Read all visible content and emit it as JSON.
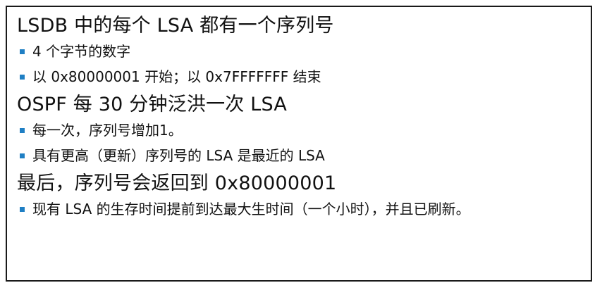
{
  "accent_color": "#1f7fc4",
  "sections": [
    {
      "heading": "LSDB 中的每个 LSA 都有一个序列号",
      "bullets": [
        "4 个字节的数字",
        "以 0x80000001 开始；以 0x7FFFFFFF 结束"
      ]
    },
    {
      "heading": "OSPF 每 30 分钟泛洪一次 LSA",
      "bullets": [
        "每一次，序列号增加1。",
        "具有更高（更新）序列号的 LSA 是最近的 LSA"
      ]
    },
    {
      "heading": "最后，序列号会返回到 0x80000001",
      "bullets": [
        "现有 LSA 的生存时间提前到达最大生时间（一个小时），并且已刷新。"
      ]
    }
  ]
}
